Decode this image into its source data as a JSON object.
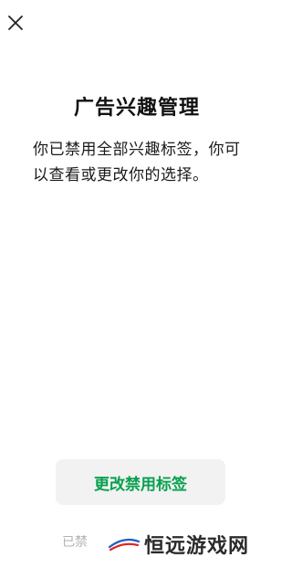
{
  "header": {
    "close_icon": "close-icon"
  },
  "main": {
    "title": "广告兴趣管理",
    "description": "你已禁用全部兴趣标签，你可以查看或更改你的选择。",
    "primary_button_label": "更改禁用标签"
  },
  "footer": {
    "partial_text": "已禁"
  },
  "watermark": {
    "text": "恒远游戏网"
  },
  "colors": {
    "accent": "#07a14f",
    "button_bg": "#f2f2f2",
    "muted_text": "#b2b2b2"
  }
}
